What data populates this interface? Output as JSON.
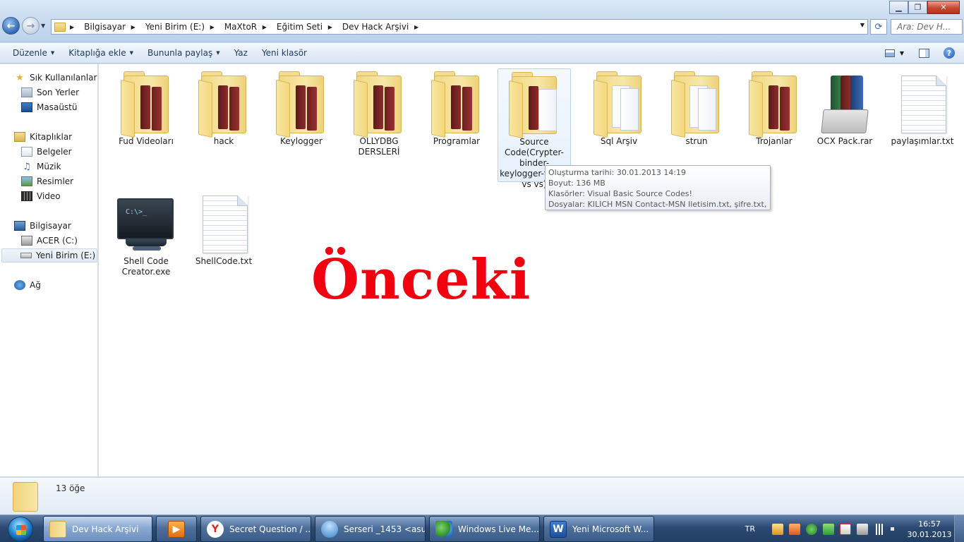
{
  "window": {
    "controls": {
      "minimize": "▁",
      "maximize": "❐",
      "close": "✕"
    }
  },
  "address": {
    "crumbs": [
      "Bilgisayar",
      "Yeni Birim (E:)",
      "MaXtoR",
      "Eğitim Seti",
      "Dev Hack Arşivi"
    ],
    "search_placeholder": "Ara: Dev H..."
  },
  "toolbar": {
    "items": [
      {
        "label": "Düzenle",
        "dropdown": true
      },
      {
        "label": "Kitaplığa ekle",
        "dropdown": true
      },
      {
        "label": "Bununla paylaş",
        "dropdown": true
      },
      {
        "label": "Yaz",
        "dropdown": false
      },
      {
        "label": "Yeni klasör",
        "dropdown": false
      }
    ]
  },
  "nav": {
    "favorites": {
      "label": "Sık Kullanılanlar",
      "icon": "star-icon"
    },
    "favorites_items": [
      {
        "label": "Son Yerler",
        "icon": "recent-places-icon"
      },
      {
        "label": "Masaüstü",
        "icon": "desktop-icon"
      }
    ],
    "libraries": {
      "label": "Kitaplıklar",
      "icon": "library-icon"
    },
    "libraries_items": [
      {
        "label": "Belgeler",
        "icon": "documents-icon"
      },
      {
        "label": "Müzik",
        "icon": "music-icon"
      },
      {
        "label": "Resimler",
        "icon": "pictures-icon"
      },
      {
        "label": "Video",
        "icon": "video-icon"
      }
    ],
    "computer": {
      "label": "Bilgisayar",
      "icon": "computer-icon"
    },
    "computer_items": [
      {
        "label": "ACER (C:)",
        "icon": "drive-icon"
      },
      {
        "label": "Yeni Birim (E:)",
        "icon": "usb-drive-icon",
        "selected": true
      }
    ],
    "network": {
      "label": "Ağ",
      "icon": "network-icon"
    }
  },
  "files": [
    {
      "name": "Fud Videoları",
      "type": "folder-books"
    },
    {
      "name": "hack",
      "type": "folder-books"
    },
    {
      "name": "Keylogger",
      "type": "folder-books"
    },
    {
      "name": "OLLYDBG DERSLERİ",
      "type": "folder-books"
    },
    {
      "name": "Programlar",
      "type": "folder-books"
    },
    {
      "name": "Source Code(Crypter-binder-keylogger-trojan vs vs)",
      "type": "folder-mixed",
      "hovered": true
    },
    {
      "name": "Sql Arşiv",
      "type": "folder-papers"
    },
    {
      "name": "strun",
      "type": "folder-papers"
    },
    {
      "name": "Trojanlar",
      "type": "folder-books"
    },
    {
      "name": "OCX Pack.rar",
      "type": "rar"
    },
    {
      "name": "paylaşımlar.txt",
      "type": "txt"
    },
    {
      "name": "Shell Code Creator.exe",
      "type": "exe"
    },
    {
      "name": "ShellCode.txt",
      "type": "txt"
    }
  ],
  "tooltip": {
    "lines": [
      "Oluşturma tarihi: 30.01.2013 14:19",
      "Boyut: 136 MB",
      "Klasörler: Visual Basic Source Codes!",
      "Dosyalar: KILICH MSN Contact-MSN Iletisim.txt, şifre.txt, ..."
    ]
  },
  "overlay_text": "Önceki",
  "details": {
    "count": "13 öğe"
  },
  "taskbar": {
    "buttons": [
      {
        "label": "Dev Hack Arşivi",
        "icon": "folder-icon",
        "active": true
      },
      {
        "label": "",
        "icon": "media-player-icon"
      },
      {
        "label": "Secret Question / ...",
        "icon": "yandex-browser-icon"
      },
      {
        "label": "Serseri _1453 <asu...",
        "icon": "messenger-contact-icon"
      },
      {
        "label": "Windows Live Me...",
        "icon": "windows-live-messenger-icon"
      },
      {
        "label": "Yeni Microsoft W...",
        "icon": "word-icon"
      }
    ],
    "lang": "TR",
    "time": "16:57",
    "date": "30.01.2013"
  },
  "colors": {
    "overlay": "#f2000f",
    "accent": "#2c4a73"
  }
}
